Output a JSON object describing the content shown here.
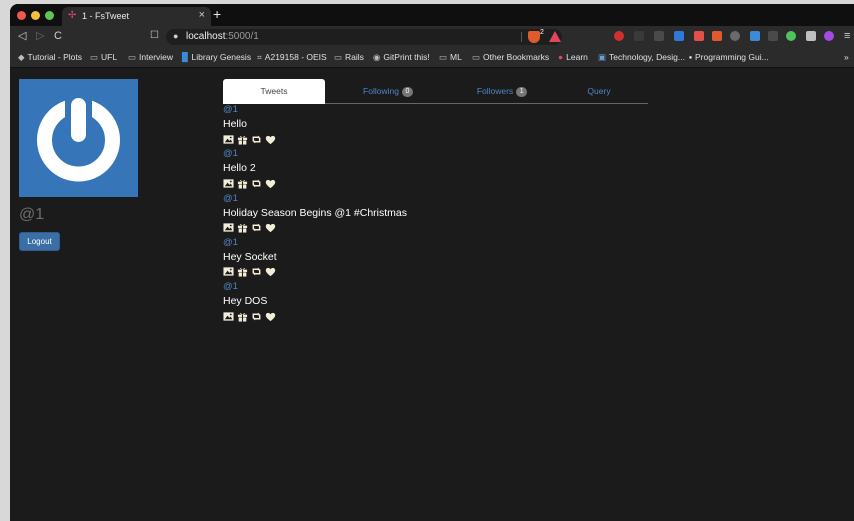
{
  "browser": {
    "tab_title": "1 - FsTweet",
    "url_host": "localhost",
    "url_path": ":5000/1",
    "brave_shield_count": "2"
  },
  "bookmarks": [
    {
      "label": "Tutorial - Plots",
      "icon": "graduation-cap-icon"
    },
    {
      "label": "UFL",
      "icon": "folder-icon"
    },
    {
      "label": "Interview",
      "icon": "folder-icon"
    },
    {
      "label": "Library Genesis",
      "icon": "library-icon"
    },
    {
      "label": "A219158 - OEIS",
      "icon": "oeis-icon"
    },
    {
      "label": "Rails",
      "icon": "folder-icon"
    },
    {
      "label": "GitPrint this!",
      "icon": "github-icon"
    },
    {
      "label": "ML",
      "icon": "folder-icon"
    },
    {
      "label": "Other Bookmarks",
      "icon": "folder-icon"
    },
    {
      "label": "Learn",
      "icon": "dot-icon"
    },
    {
      "label": "Technology, Desig...",
      "icon": "site-icon"
    },
    {
      "label": "Programming Gui...",
      "icon": "site-icon"
    }
  ],
  "profile": {
    "handle": "@1",
    "logout_label": "Logout",
    "avatar_color": "#3676b8"
  },
  "tabs": {
    "tweets": "Tweets",
    "following": "Following",
    "following_count": "0",
    "followers": "Followers",
    "followers_count": "1",
    "query": "Query"
  },
  "tweets": [
    {
      "user": "@1",
      "text": "Hello"
    },
    {
      "user": "@1",
      "text": "Hello 2"
    },
    {
      "user": "@1",
      "text": "Holiday Season Begins @1 #Christmas"
    },
    {
      "user": "@1",
      "text": "Hey Socket"
    },
    {
      "user": "@1",
      "text": "Hey DOS"
    }
  ],
  "colors": {
    "accent_link": "#4f86c6",
    "page_bg": "#1b1b1b",
    "action_icon": "#f3ecd6"
  }
}
